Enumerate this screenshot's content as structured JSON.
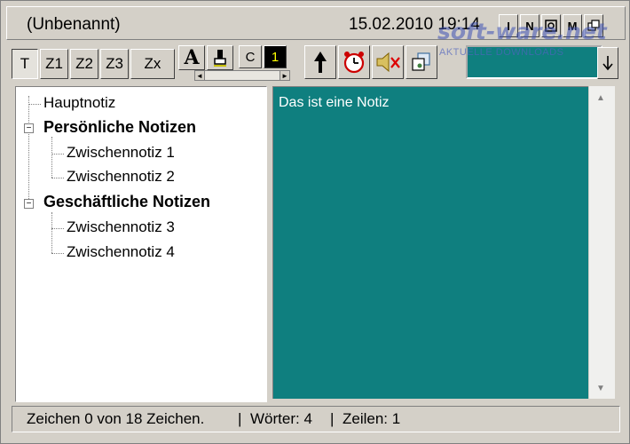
{
  "window": {
    "title": "(Unbenannt)",
    "datetime": "15.02.2010 19:14",
    "title_buttons": [
      "I",
      "N",
      "",
      "M",
      ""
    ]
  },
  "watermark": {
    "main": "soft-ware.net",
    "sub": "AKTUELLE DOWNLOADS"
  },
  "toolbar": {
    "tabs": [
      {
        "label": "T",
        "icon": "text-tab"
      },
      {
        "label": "Z1"
      },
      {
        "label": "Z2"
      },
      {
        "label": "Z3"
      },
      {
        "label": "Zx"
      }
    ],
    "font_glyph": "A",
    "color_c_label": "C",
    "color_index_label": "1",
    "icons": [
      "font-icon",
      "highlighter-icon",
      "up-arrow-icon",
      "alarm-clock-icon",
      "speaker-mute-icon",
      "copy-icon",
      "scroll-down-icon"
    ],
    "note_color": "#0f7f7f"
  },
  "tree": {
    "items": [
      {
        "label": "Hauptnotiz",
        "level": 0,
        "bold": false
      },
      {
        "label": "Persönliche Notizen",
        "level": 0,
        "bold": true
      },
      {
        "label": "Zwischennotiz 1",
        "level": 1,
        "bold": false
      },
      {
        "label": "Zwischennotiz 2",
        "level": 1,
        "bold": false
      },
      {
        "label": "Geschäftliche Notizen",
        "level": 0,
        "bold": true
      },
      {
        "label": "Zwischennotiz 3",
        "level": 1,
        "bold": false
      },
      {
        "label": "Zwischennotiz 4",
        "level": 1,
        "bold": false
      }
    ],
    "expander_glyph": "−"
  },
  "note": {
    "text": "Das ist eine Notiz",
    "background": "#0f7f7f"
  },
  "status": {
    "chars": "Zeichen 0 von 18 Zeichen.",
    "sep1": "|",
    "words": "Wörter: 4",
    "sep2": "|",
    "lines": "Zeilen: 1"
  }
}
